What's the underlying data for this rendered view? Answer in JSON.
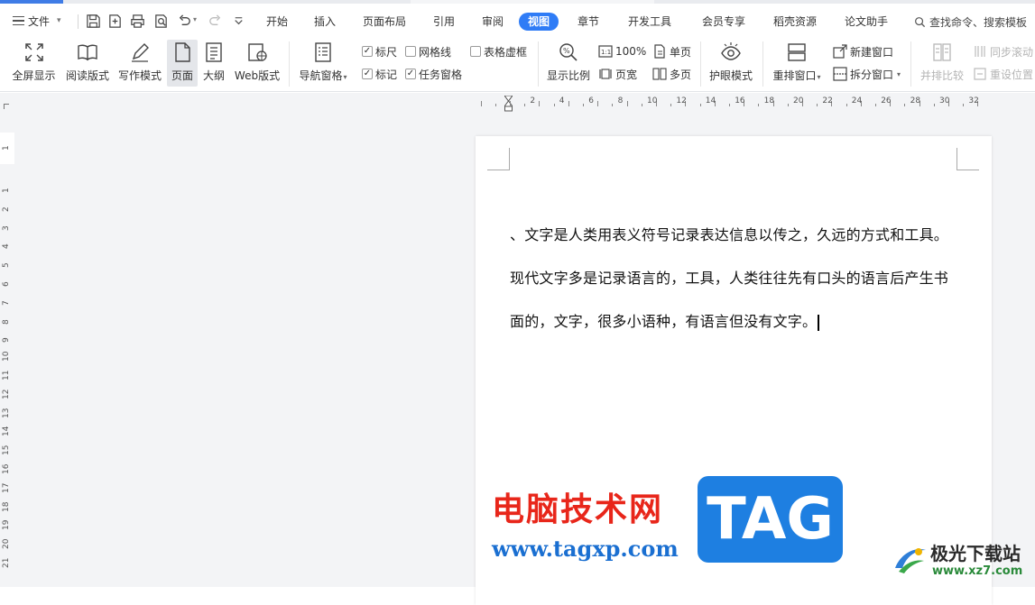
{
  "menubar": {
    "file_label": "文件",
    "tabs": [
      "开始",
      "插入",
      "页面布局",
      "引用",
      "审阅",
      "视图",
      "章节",
      "开发工具",
      "会员专享",
      "稻壳资源",
      "论文助手"
    ],
    "active_tab": "视图",
    "search_label": "查找命令、搜索模板"
  },
  "ribbon": {
    "fullscreen": "全屏显示",
    "reading": "阅读版式",
    "writing": "写作模式",
    "page": "页面",
    "outline": "大纲",
    "web": "Web版式",
    "nav_pane": "导航窗格",
    "ruler": "标尺",
    "gridlines": "网格线",
    "table_gridlines": "表格虚框",
    "marks": "标记",
    "task_pane": "任务窗格",
    "zoom": "显示比例",
    "zoom_100": "100%",
    "page_width": "页宽",
    "single_page": "单页",
    "multi_page": "多页",
    "eye_protect": "护眼模式",
    "rearrange": "重排窗口",
    "new_window": "新建窗口",
    "split_window": "拆分窗口",
    "side_by_side": "并排比较",
    "sync_scroll": "同步滚动",
    "reset_position": "重设位置"
  },
  "checkboxes": {
    "ruler": true,
    "gridlines": false,
    "table_gridlines": false,
    "marks": true,
    "task_pane": true
  },
  "hruler": {
    "numbers": [
      "2",
      "4",
      "6",
      "8",
      "10",
      "12",
      "14",
      "16",
      "18",
      "20",
      "22",
      "24",
      "26",
      "28",
      "30",
      "32"
    ]
  },
  "vruler": {
    "numbers": [
      "1",
      "1",
      "2",
      "3",
      "4",
      "5",
      "6",
      "7",
      "8",
      "9",
      "10",
      "11",
      "12",
      "13",
      "14",
      "15",
      "16",
      "17",
      "18",
      "19",
      "20",
      "21"
    ]
  },
  "document": {
    "lines": [
      "、文字是人类用表义符号记录表达信息以传之，久远的方式和工具。",
      "现代文字多是记录语言的，工具，人类往往先有口头的语言后产生书",
      "面的，文字，很多小语种，有语言但没有文字。"
    ]
  },
  "watermark": {
    "site_name": "电脑技术网",
    "site_url": "www.tagxp.com",
    "tag": "TAG",
    "brand2": "极光下载站",
    "brand2_url": "www.xz7.com"
  },
  "colors": {
    "accent": "#2f7cf6",
    "watermark_red": "#e8261a",
    "watermark_blue": "#1e7fe1"
  }
}
